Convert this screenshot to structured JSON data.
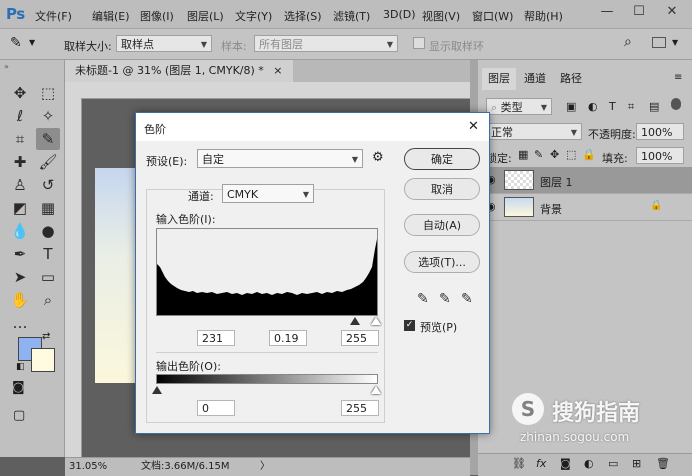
{
  "app": {
    "logo": "Ps"
  },
  "menu": [
    "文件(F)",
    "编辑(E)",
    "图像(I)",
    "图层(L)",
    "文字(Y)",
    "选择(S)",
    "滤镜(T)",
    "3D(D)",
    "视图(V)",
    "窗口(W)",
    "帮助(H)"
  ],
  "window_controls": {
    "minimize": "—",
    "maximize": "☐",
    "close": "✕"
  },
  "options_bar": {
    "sample_size_label": "取样大小:",
    "sample_size_value": "取样点",
    "sample_label": "样本:",
    "sample_value": "所有图层",
    "show_ring_label": "显示取样环"
  },
  "document": {
    "tab_title": "未标题-1 @ 31% (图层 1, CMYK/8) *",
    "tab_close": "×",
    "zoom": "31.05%",
    "doc_info": "文档:3.66M/6.15M",
    "status_arrow": "〉"
  },
  "layers_panel": {
    "tabs": [
      "图层",
      "通道",
      "路径"
    ],
    "filter_kind": "类型",
    "blend_mode": "正常",
    "opacity_label": "不透明度:",
    "opacity_value": "100%",
    "lock_label": "锁定:",
    "fill_label": "填充:",
    "fill_value": "100%",
    "layers": [
      {
        "name": "图层 1",
        "selected": true
      },
      {
        "name": "背景",
        "selected": false
      }
    ],
    "bottom_icons": [
      "link-icon",
      "fx-icon",
      "mask-icon",
      "adjustment-icon",
      "folder-icon",
      "new-layer-icon",
      "trash-icon"
    ]
  },
  "levels_dialog": {
    "title": "色阶",
    "close": "✕",
    "preset_label": "预设(E):",
    "preset_value": "自定",
    "channel_label": "通道:",
    "channel_value": "CMYK",
    "input_levels_label": "输入色阶(I):",
    "input_values": [
      "231",
      "0.19",
      "255"
    ],
    "output_levels_label": "输出色阶(O):",
    "output_values": [
      "0",
      "255"
    ],
    "buttons": {
      "ok": "确定",
      "cancel": "取消",
      "auto": "自动(A)",
      "options": "选项(T)..."
    },
    "preview_label": "预览(P)",
    "preview_checked": true
  },
  "watermark": {
    "brand": "搜狗指南",
    "url": "zhinan.sogou.com"
  },
  "colors": {
    "accent": "#3a6ea5",
    "foreground": "#8fb2f0",
    "background": "#fffbe0"
  }
}
